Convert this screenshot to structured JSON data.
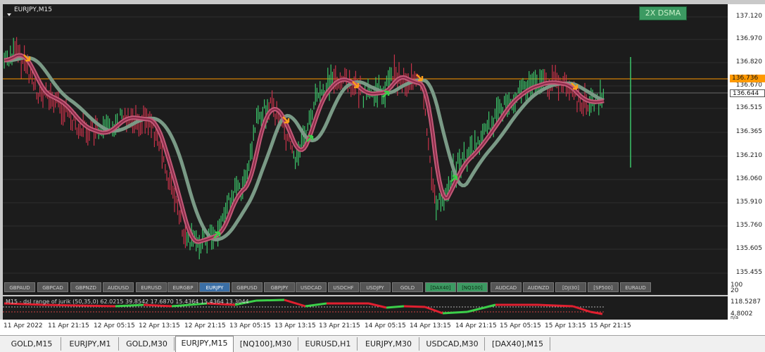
{
  "chart": {
    "title": "EURJPY,M15",
    "indicator_badge": "2X DSMA",
    "price_labels": [
      "137.120",
      "136.970",
      "136.820",
      "136.670",
      "136.515",
      "136.365",
      "136.210",
      "136.060",
      "135.910",
      "135.760",
      "135.605",
      "135.455"
    ],
    "current_price": "136.644",
    "alert_price": "136.736",
    "alert_price_color": "#ff9900",
    "grid_color": "#2e2e2e",
    "bull_color": "#3cc46a",
    "bear_color": "#c8324a"
  },
  "symbol_bar": {
    "symbols": [
      {
        "label": "GBPAUD",
        "state": "normal"
      },
      {
        "label": "GBPCAD",
        "state": "normal"
      },
      {
        "label": "GBPNZD",
        "state": "normal"
      },
      {
        "label": "AUDUSD",
        "state": "normal"
      },
      {
        "label": "EURUSD",
        "state": "normal"
      },
      {
        "label": "EURGBP",
        "state": "normal"
      },
      {
        "label": "EURJPY",
        "state": "active"
      },
      {
        "label": "GBPUSD",
        "state": "normal"
      },
      {
        "label": "GBPJPY",
        "state": "normal"
      },
      {
        "label": "USDCAD",
        "state": "normal"
      },
      {
        "label": "USDCHF",
        "state": "normal"
      },
      {
        "label": "USDJPY",
        "state": "normal"
      },
      {
        "label": "GOLD",
        "state": "normal"
      },
      {
        "label": "[DAX40]",
        "state": "green"
      },
      {
        "label": "[NQ100]",
        "state": "green"
      },
      {
        "label": "AUDCAD",
        "state": "normal"
      },
      {
        "label": "AUDNZD",
        "state": "normal"
      },
      {
        "label": "[DJI30]",
        "state": "normal"
      },
      {
        "label": "[SP500]",
        "state": "normal"
      },
      {
        "label": "EURAUD",
        "state": "normal"
      }
    ]
  },
  "indicator": {
    "label": "M15 - dsl range of jurik (50,35,0) 62.0215 39.8542 17.6870 15.4364 15.4364 13.3044",
    "axis_labels": {
      "top": "100",
      "second": "20",
      "v1": "118.5287",
      "v2": "4.8002",
      "bottom": "n/a"
    }
  },
  "time_axis": {
    "labels": [
      "11 Apr 2022",
      "11 Apr 21:15",
      "12 Apr 05:15",
      "12 Apr 13:15",
      "12 Apr 21:15",
      "13 Apr 05:15",
      "13 Apr 13:15",
      "13 Apr 21:15",
      "14 Apr 05:15",
      "14 Apr 13:15",
      "14 Apr 21:15",
      "15 Apr 05:15",
      "15 Apr 13:15",
      "15 Apr 21:15"
    ]
  },
  "tabs": [
    {
      "label": "GOLD,M15",
      "active": false
    },
    {
      "label": "EURJPY,M1",
      "active": false
    },
    {
      "label": "GOLD,M30",
      "active": false
    },
    {
      "label": "EURJPY,M15",
      "active": true
    },
    {
      "label": "[NQ100],M30",
      "active": false
    },
    {
      "label": "EURUSD,H1",
      "active": false
    },
    {
      "label": "EURJPY,M30",
      "active": false
    },
    {
      "label": "USDCAD,M30",
      "active": false
    },
    {
      "label": "[DAX40],M15",
      "active": false
    }
  ]
}
